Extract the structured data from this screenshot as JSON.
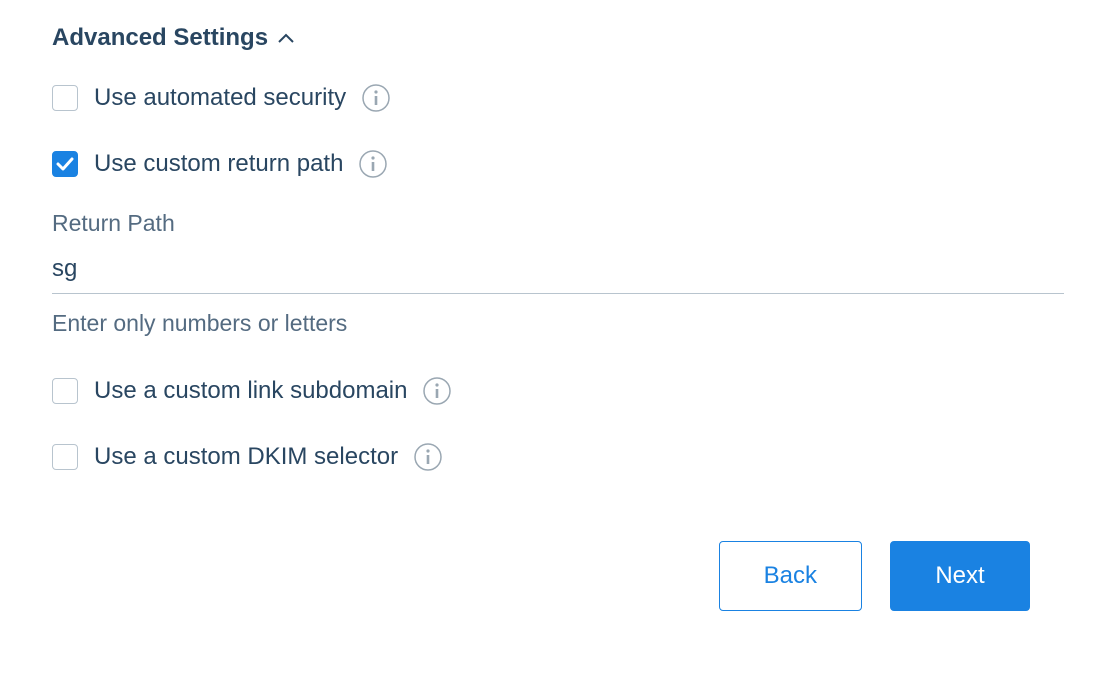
{
  "section": {
    "title": "Advanced Settings"
  },
  "options": {
    "automatedSecurity": {
      "label": "Use automated security",
      "checked": false
    },
    "customReturnPath": {
      "label": "Use custom return path",
      "checked": true
    },
    "customLinkSubdomain": {
      "label": "Use a custom link subdomain",
      "checked": false
    },
    "customDkimSelector": {
      "label": "Use a custom DKIM selector",
      "checked": false
    }
  },
  "returnPath": {
    "label": "Return Path",
    "value": "sg",
    "helpText": "Enter only numbers or letters"
  },
  "buttons": {
    "back": "Back",
    "next": "Next"
  }
}
